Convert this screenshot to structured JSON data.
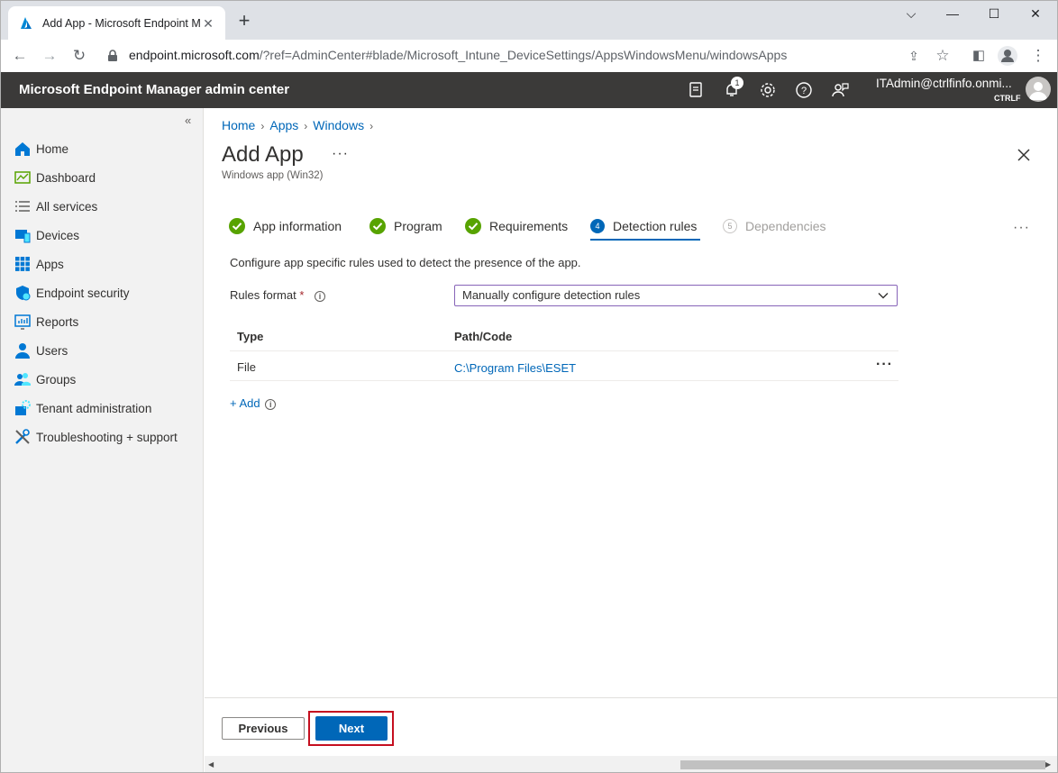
{
  "browser": {
    "tab_title": "Add App - Microsoft Endpoint M",
    "url_host": "endpoint.microsoft.com",
    "url_rest": "/?ref=AdminCenter#blade/Microsoft_Intune_DeviceSettings/AppsWindowsMenu/windowsApps"
  },
  "header": {
    "brand": "Microsoft Endpoint Manager admin center",
    "notification_count": "1",
    "user": "ITAdmin@ctrlfinfo.onmi...",
    "tenant": "CTRLF"
  },
  "nav": {
    "collapse": "«",
    "items": [
      {
        "label": "Home"
      },
      {
        "label": "Dashboard"
      },
      {
        "label": "All services"
      },
      {
        "label": "Devices"
      },
      {
        "label": "Apps"
      },
      {
        "label": "Endpoint security"
      },
      {
        "label": "Reports"
      },
      {
        "label": "Users"
      },
      {
        "label": "Groups"
      },
      {
        "label": "Tenant administration"
      },
      {
        "label": "Troubleshooting + support"
      }
    ]
  },
  "breadcrumb": [
    "Home",
    "Apps",
    "Windows"
  ],
  "page": {
    "title": "Add App",
    "more": "···",
    "subtitle": "Windows app (Win32)"
  },
  "steps": [
    {
      "label": "App information",
      "state": "done"
    },
    {
      "label": "Program",
      "state": "done"
    },
    {
      "label": "Requirements",
      "state": "done"
    },
    {
      "label": "Detection rules",
      "state": "active",
      "number": "4"
    },
    {
      "label": "Dependencies",
      "state": "disabled",
      "number": "5"
    }
  ],
  "content": {
    "description": "Configure app specific rules used to detect the presence of the app.",
    "rules_format_label": "Rules format",
    "required_marker": "*",
    "rules_format_value": "Manually configure detection rules",
    "table": {
      "headers": [
        "Type",
        "Path/Code"
      ],
      "rows": [
        {
          "type": "File",
          "path": "C:\\Program Files\\ESET"
        }
      ]
    },
    "add_label": "+ Add"
  },
  "footer": {
    "previous": "Previous",
    "next": "Next"
  },
  "colors": {
    "header_bg": "#3b3a39",
    "accent": "#0067b8",
    "success": "#57a300",
    "highlight": "#c50f1f"
  }
}
